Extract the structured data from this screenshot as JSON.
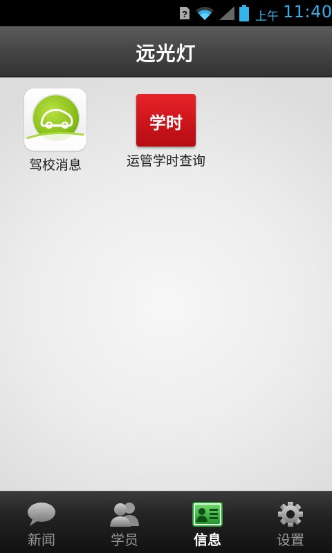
{
  "status_bar": {
    "ampm": "上午",
    "time": "11:40",
    "icons": [
      "sim-unknown-icon",
      "wifi-icon",
      "signal-icon",
      "battery-icon"
    ]
  },
  "title_bar": {
    "title": "远光灯"
  },
  "apps": [
    {
      "label": "驾校消息",
      "icon": "car-icon"
    },
    {
      "label": "运管学时查询",
      "icon": "study-hours-icon",
      "icon_text": "学时"
    }
  ],
  "bottom_nav": {
    "active": "信息",
    "items": [
      {
        "label": "新闻",
        "icon": "chat-bubble-icon"
      },
      {
        "label": "学员",
        "icon": "people-icon"
      },
      {
        "label": "信息",
        "icon": "id-card-icon"
      },
      {
        "label": "设置",
        "icon": "gear-icon"
      }
    ]
  },
  "colors": {
    "status_accent": "#36b3e6",
    "active_nav_icon": "#3cb04a",
    "study_icon_red": "#d8181f",
    "driving_icon_green": "#8cc21c"
  }
}
